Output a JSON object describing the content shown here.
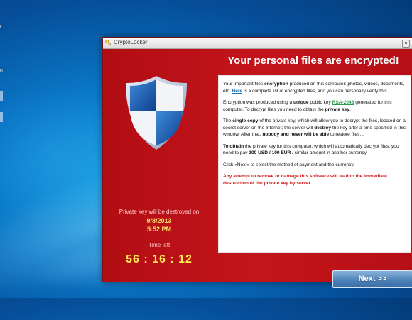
{
  "desktop": {
    "label_1": "r",
    "label_2": "n"
  },
  "window": {
    "title": "CryptoLocker",
    "close_glyph": "×"
  },
  "main": {
    "headline": "Your personal files are encrypted!"
  },
  "left": {
    "destroy_label": "Private key will be destroyed on",
    "destroy_date": "9/8/2013",
    "destroy_time": "5:52 PM",
    "time_left_label": "Time left",
    "countdown": "56 : 16 : 12"
  },
  "info": {
    "p1_a": "Your important files ",
    "p1_b": "encryption",
    "p1_c": " produced on this computer: photos, videos, documents, etc. ",
    "p1_link": "Here",
    "p1_d": " is a complete list of encrypted files, and you can personally verify this.",
    "p2_a": "Encryption was produced using a ",
    "p2_b": "unique",
    "p2_c": " public key ",
    "p2_link": "RSA-2048",
    "p2_d": " generated for this computer. To decrypt files you need to obtain the ",
    "p2_e": "private key",
    "p2_f": ".",
    "p3_a": "The ",
    "p3_b": "single copy",
    "p3_c": " of the private key, which will allow you to decrypt the files, located on a secret server on the Internet; the server will ",
    "p3_d": "destroy",
    "p3_e": " the key after a time specified in this window. After that, ",
    "p3_f": "nobody and never will be able",
    "p3_g": " to restore files...",
    "p4_a": "To obtain",
    "p4_b": " the private key for this computer, which will automatically decrypt files, you need to pay ",
    "p4_c": "100 USD / 100 EUR",
    "p4_d": " / similar amount in another currency.",
    "p5": "Click «Next» to select the method of payment and the currency.",
    "warning": "Any attempt to remove or damage this software will lead to the immediate destruction of the private key by server."
  },
  "buttons": {
    "next": "Next >>"
  },
  "colors": {
    "window_red": "#b50f15",
    "countdown_yellow": "#ffe94d",
    "warning_red": "#d01a1a",
    "link_blue": "#1c6fb4",
    "link_green": "#2f9a4b"
  }
}
